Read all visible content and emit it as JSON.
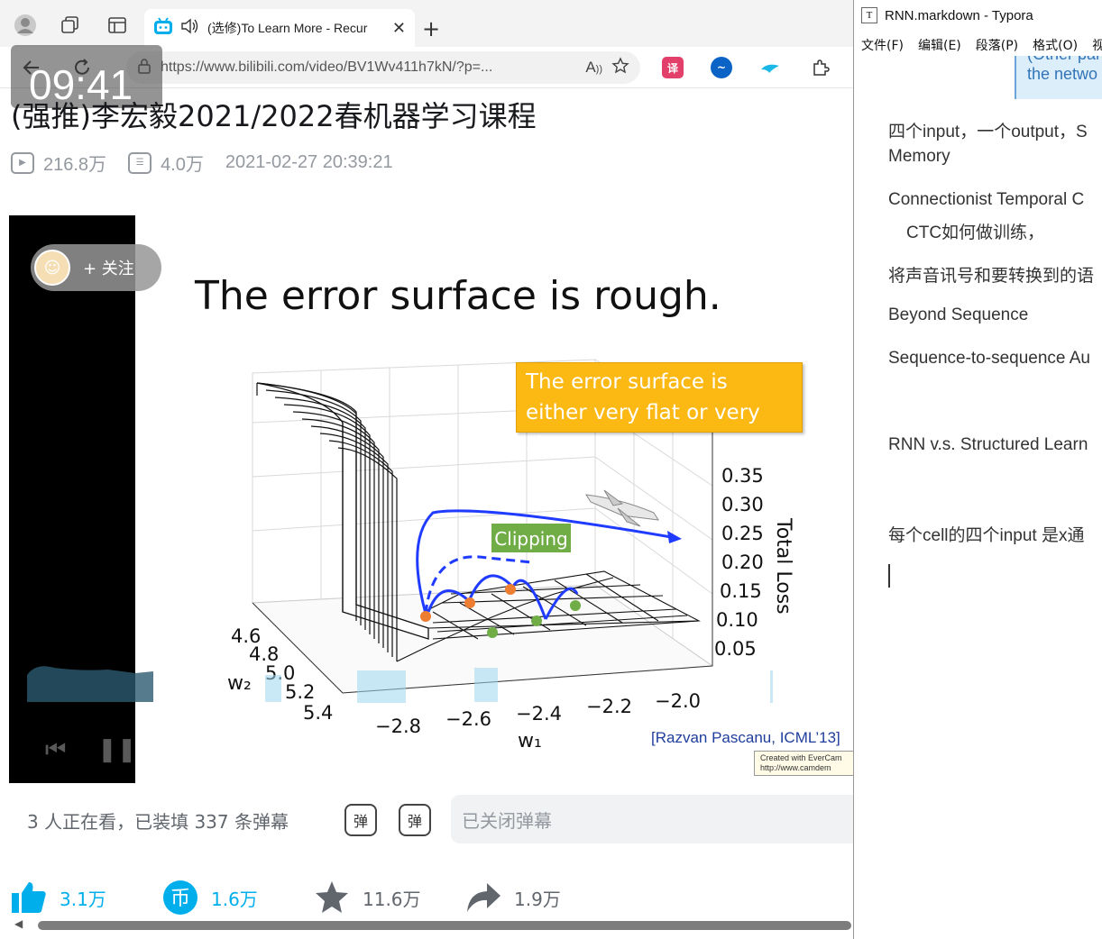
{
  "browser": {
    "tab_title": "(选修)To Learn More - Recur",
    "url": "https://www.bilibili.com/video/BV1Wv411h7kN/?p=...",
    "clock": "09:41",
    "new_tab": "+",
    "tab_close": "✕"
  },
  "video": {
    "title": "(强推)李宏毅2021/2022春机器学习课程",
    "views": "216.8万",
    "danmaku_count": "4.0万",
    "date": "2021-02-27 20:39:21"
  },
  "player": {
    "follow_label": "+ 关注",
    "slide_title": "The error surface is rough.",
    "callout": "The error surface is either very flat or very steep.",
    "clipping_label": "Clipping",
    "axis_z_label": "Total Loss",
    "axis_x_label": "w₁",
    "axis_y_label": "w₂",
    "z_ticks": [
      "0.35",
      "0.30",
      "0.25",
      "0.20",
      "0.15",
      "0.10",
      "0.05"
    ],
    "x_ticks": [
      "−2.8",
      "−2.6",
      "−2.4",
      "−2.2",
      "−2.0"
    ],
    "y_ticks": [
      "4.6",
      "4.8",
      "5.0",
      "5.2",
      "5.4"
    ],
    "citation": "[Razvan Pascanu, ICML’13]",
    "watermark_line1": "Created with EverCam",
    "watermark_line2": "http://www.camdem"
  },
  "danmaku": {
    "watching": "3 人正在看，已装填 337 条弹幕",
    "input_placeholder": "已关闭弹幕",
    "btn1": "弹",
    "btn2": "弹"
  },
  "actions": {
    "like": "3.1万",
    "coin": "1.6万",
    "favorite": "11.6万",
    "share": "1.9万"
  },
  "typora": {
    "window_title": "RNN.markdown - Typora",
    "menu": [
      "文件(F)",
      "编辑(E)",
      "段落(P)",
      "格式(O)",
      "视"
    ],
    "quote_top": "(Other par",
    "quote_text": "the netwo",
    "paragraphs": [
      "四个input，一个output，S",
      "Memory",
      "Connectionist Temporal C",
      "CTC如何做训练，",
      "将声音讯号和要转换到的语",
      "Beyond Sequence",
      "Sequence-to-sequence Au",
      "RNN v.s. Structured Learn",
      "每个cell的四个input 是x通"
    ]
  },
  "colors": {
    "accent_blue": "#00aeec",
    "callout_orange": "#fcb813",
    "clipping_green": "#70ad47",
    "arrow_blue": "#1f3bff"
  }
}
